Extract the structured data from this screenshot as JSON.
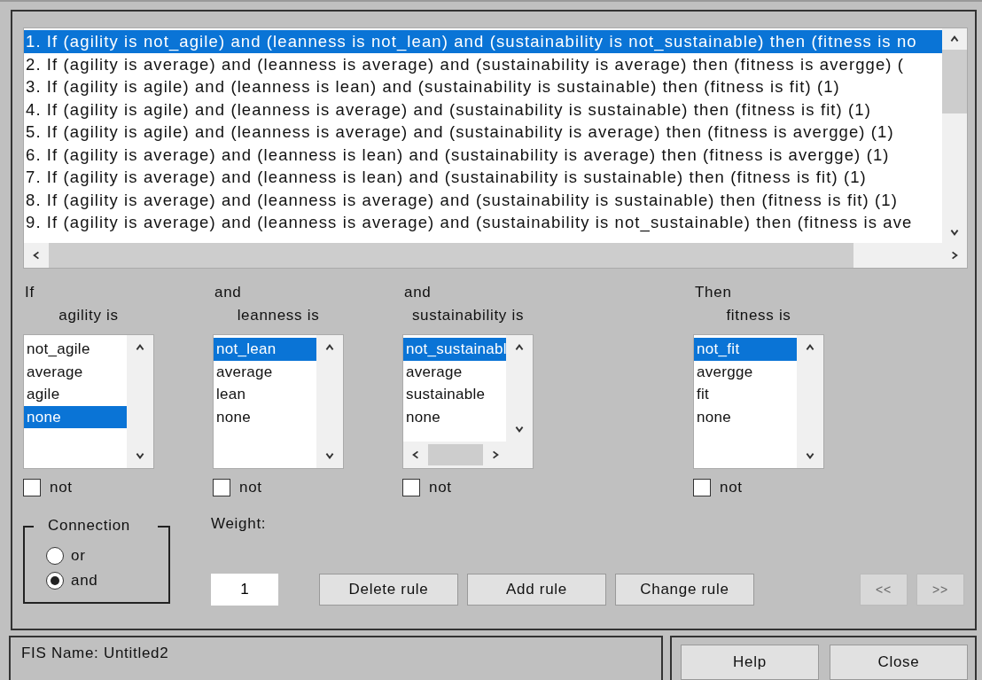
{
  "rules": {
    "items": [
      {
        "text": "1. If (agility is not_agile) and (leanness is not_lean) and (sustainability is not_sustainable) then (fitness is no",
        "selected": true
      },
      {
        "text": "2. If (agility is average) and (leanness is average) and (sustainability is average) then (fitness is avergge) (",
        "selected": false
      },
      {
        "text": "3. If (agility is agile) and (leanness is lean) and (sustainability is sustainable) then (fitness is fit) (1)",
        "selected": false
      },
      {
        "text": "4. If (agility is agile) and (leanness is average) and (sustainability is sustainable) then (fitness is fit) (1)",
        "selected": false
      },
      {
        "text": "5. If (agility is agile) and (leanness is average) and (sustainability is average) then (fitness is avergge) (1)",
        "selected": false
      },
      {
        "text": "6. If (agility is average) and (leanness is lean) and (sustainability is average) then (fitness is avergge) (1)",
        "selected": false
      },
      {
        "text": "7. If (agility is average) and (leanness is lean) and (sustainability is sustainable) then (fitness is fit) (1)",
        "selected": false
      },
      {
        "text": "8. If (agility is average) and (leanness is average) and (sustainability is sustainable) then (fitness is fit) (1)",
        "selected": false
      },
      {
        "text": "9. If (agility is average) and (leanness is average) and (sustainability is not_sustainable) then (fitness is ave",
        "selected": false
      }
    ]
  },
  "variables": [
    {
      "connector": "If",
      "label": "agility is",
      "horizontal_scroll": false,
      "options": [
        {
          "label": "not_agile",
          "selected": false
        },
        {
          "label": "average",
          "selected": false
        },
        {
          "label": "agile",
          "selected": false
        },
        {
          "label": "none",
          "selected": true
        }
      ],
      "not": {
        "label": "not",
        "checked": false
      }
    },
    {
      "connector": "and",
      "label": "leanness is",
      "horizontal_scroll": false,
      "options": [
        {
          "label": "not_lean",
          "selected": true
        },
        {
          "label": "average",
          "selected": false
        },
        {
          "label": "lean",
          "selected": false
        },
        {
          "label": "none",
          "selected": false
        }
      ],
      "not": {
        "label": "not",
        "checked": false
      }
    },
    {
      "connector": "and",
      "label": "sustainability is",
      "horizontal_scroll": true,
      "options": [
        {
          "label": "not_sustainabl",
          "selected": true
        },
        {
          "label": "average",
          "selected": false
        },
        {
          "label": "sustainable",
          "selected": false
        },
        {
          "label": "none",
          "selected": false
        }
      ],
      "not": {
        "label": "not",
        "checked": false
      }
    },
    {
      "connector": "Then",
      "label": "fitness is",
      "horizontal_scroll": false,
      "options": [
        {
          "label": "not_fit",
          "selected": true
        },
        {
          "label": "avergge",
          "selected": false
        },
        {
          "label": "fit",
          "selected": false
        },
        {
          "label": "none",
          "selected": false
        }
      ],
      "not": {
        "label": "not",
        "checked": false
      }
    }
  ],
  "connection": {
    "title": "Connection",
    "options": [
      {
        "label": "or",
        "selected": false
      },
      {
        "label": "and",
        "selected": true
      }
    ]
  },
  "weight": {
    "label": "Weight:",
    "value": "1"
  },
  "rule_buttons": [
    {
      "label": "Delete rule",
      "disabled": false
    },
    {
      "label": "Add rule",
      "disabled": false
    },
    {
      "label": "Change rule",
      "disabled": false
    }
  ],
  "nav_buttons": [
    {
      "label": "<<",
      "disabled": true
    },
    {
      "label": ">>",
      "disabled": true
    }
  ],
  "status": {
    "text": "FIS Name: Untitled2"
  },
  "footer_buttons": [
    {
      "label": "Help",
      "disabled": false
    },
    {
      "label": "Close",
      "disabled": false
    }
  ]
}
